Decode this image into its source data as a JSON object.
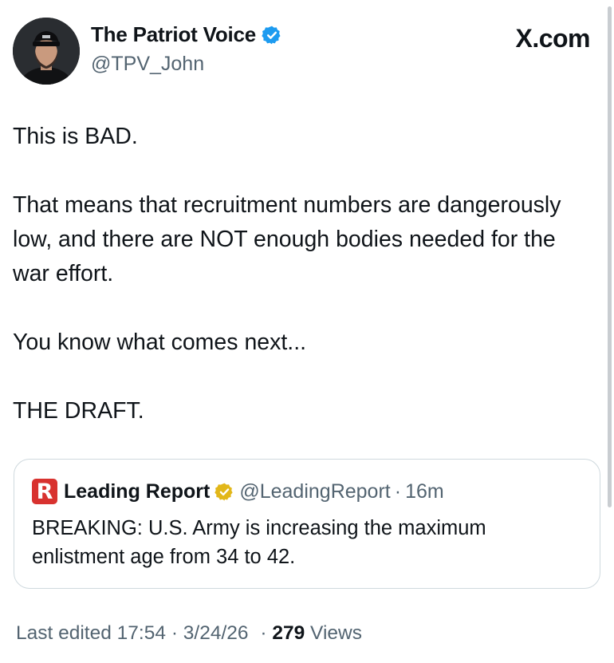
{
  "author": {
    "name": "The Patriot Voice",
    "handle": "@TPV_John",
    "verified": true,
    "badge_color": "#1d9bf0"
  },
  "brand": {
    "logo_text": "X.com"
  },
  "tweet": {
    "paragraphs": [
      "This is BAD.",
      "That means that recruitment numbers are dangerously low, and there are NOT enough bodies needed for the war effort.",
      "You know what comes next...",
      "THE DRAFT."
    ]
  },
  "quote": {
    "logo_letter": "R",
    "logo_color": "#d8322f",
    "name": "Leading Report",
    "badge_color": "#e2b719",
    "handle": "@LeadingReport",
    "separator": "·",
    "time": "16m",
    "text": "BREAKING: U.S. Army is increasing the maximum enlistment age from 34 to 42."
  },
  "meta": {
    "edited_label": "Last edited 17:54",
    "separator": "·",
    "date": "3/24/26",
    "views_count": "279",
    "views_label": "Views"
  }
}
